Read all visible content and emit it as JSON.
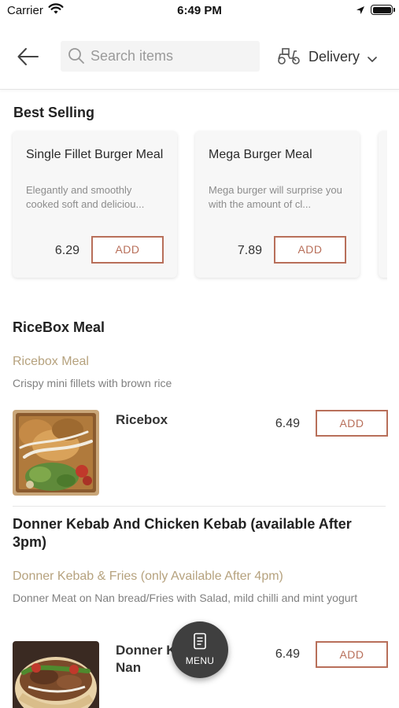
{
  "status_bar": {
    "carrier": "Carrier",
    "time": "6:49 PM"
  },
  "header": {
    "search_placeholder": "Search items",
    "delivery_label": "Delivery"
  },
  "best_selling": {
    "title": "Best Selling",
    "items": [
      {
        "name": "Single Fillet Burger Meal",
        "description": "Elegantly and smoothly cooked soft and deliciou...",
        "price": "6.29",
        "add_label": "ADD"
      },
      {
        "name": "Mega Burger Meal",
        "description": "Mega burger will surprise you with the amount of cl...",
        "price": "7.89",
        "add_label": "ADD"
      }
    ]
  },
  "sections": [
    {
      "title": "RiceBox Meal",
      "subtitle": "Ricebox Meal",
      "description": "Crispy mini fillets with brown rice",
      "items": [
        {
          "name": "Ricebox",
          "price": "6.49",
          "add_label": "ADD"
        }
      ]
    },
    {
      "title": "Donner Kebab And Chicken Kebab (available After 3pm)",
      "subtitle": "Donner Kebab & Fries (only Available After 4pm)",
      "description": "Donner Meat on Nan bread/Fries with Salad, mild chilli and mint yogurt",
      "items": [
        {
          "name": "Donner Kebab on Nan",
          "price": "6.49",
          "add_label": "ADD"
        }
      ]
    }
  ],
  "menu_button": {
    "label": "MENU"
  },
  "colors": {
    "accent": "#b86f5a",
    "subtitle": "#b6a27e",
    "fab": "#3f3f3f"
  }
}
